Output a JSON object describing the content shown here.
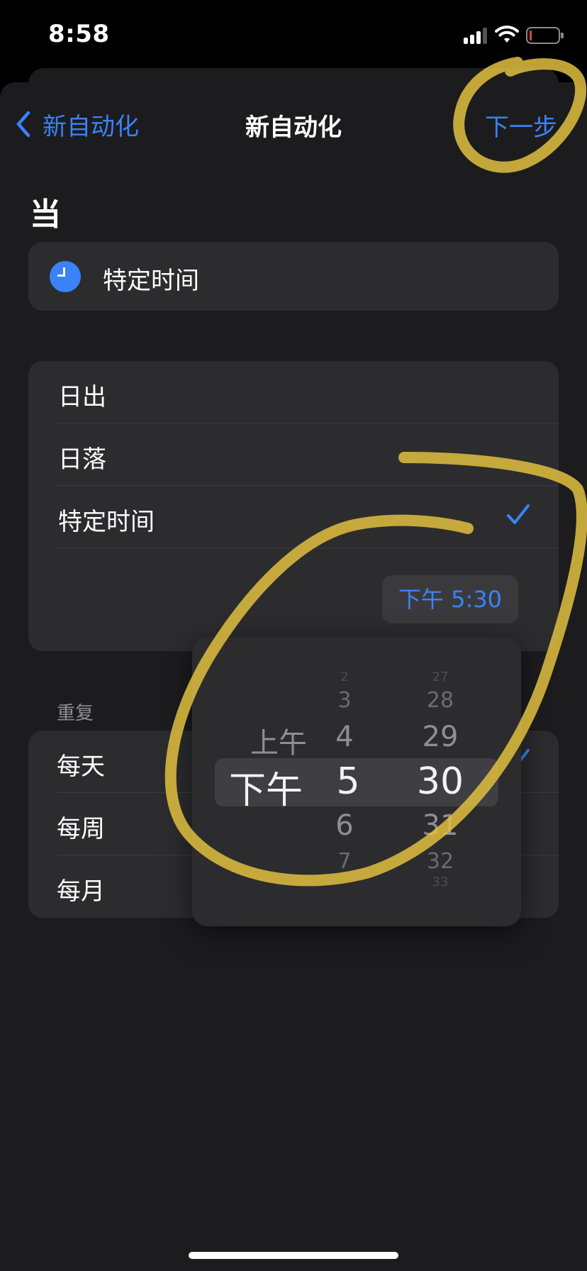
{
  "status_bar": {
    "time": "8:58",
    "battery_level": 0.08
  },
  "nav": {
    "back_label": "新自动化",
    "title": "新自动化",
    "next_label": "下一步"
  },
  "section": {
    "title": "当"
  },
  "trigger": {
    "label": "特定时间",
    "icon": "clock-icon"
  },
  "options": [
    {
      "label": "日出",
      "selected": false
    },
    {
      "label": "日落",
      "selected": false
    },
    {
      "label": "特定时间",
      "selected": true
    }
  ],
  "time_value": "下午 5:30",
  "repeat": {
    "header": "重复",
    "items": [
      {
        "label": "每天",
        "selected": true
      },
      {
        "label": "每周",
        "selected": false
      },
      {
        "label": "每月",
        "selected": false
      }
    ]
  },
  "picker": {
    "period": {
      "options": [
        "上午",
        "下午"
      ],
      "selected": "下午"
    },
    "hour": {
      "visible": [
        "2",
        "3",
        "4",
        "5",
        "6",
        "7"
      ],
      "selected": "5"
    },
    "minute": {
      "visible": [
        "27",
        "28",
        "29",
        "30",
        "31",
        "32",
        "33"
      ],
      "selected": "30"
    }
  },
  "colors": {
    "accent": "#3a82f7",
    "background": "#1c1c1e",
    "card": "#2c2c2e",
    "annotation": "#e0c040"
  }
}
